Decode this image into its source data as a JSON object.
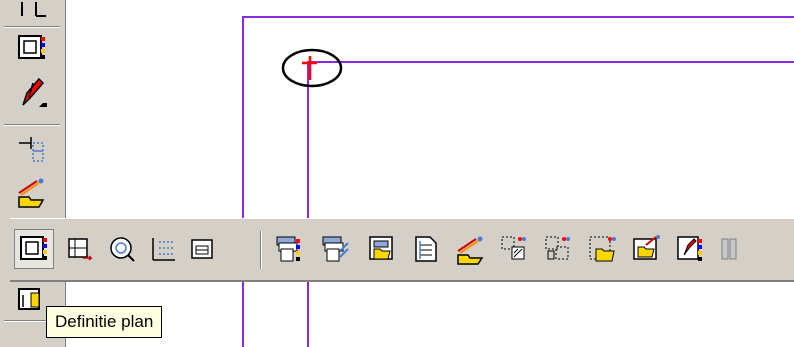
{
  "tooltip": {
    "text": "Definitie plan"
  },
  "colors": {
    "line": "#8a2be2",
    "toolbar": "#d4d0c8",
    "marker": "#ff0000",
    "tooltip_bg": "#ffffe1"
  },
  "vertical_toolbar": {
    "items": [
      {
        "icon": "frame-top-icon"
      },
      {
        "icon": "plan-frame-icon"
      },
      {
        "icon": "pencil-red-icon"
      },
      {
        "icon": "align-grid-icon"
      },
      {
        "icon": "open-folder-pen-icon"
      },
      {
        "icon": "text-frame-icon"
      }
    ]
  },
  "horizontal_toolbar": {
    "items": [
      {
        "icon": "definition-plan-icon",
        "pressed": true
      },
      {
        "icon": "grid-add-icon"
      },
      {
        "icon": "zoom-frame-icon"
      },
      {
        "icon": "grid-lines-icon"
      },
      {
        "icon": "window-frame-icon"
      },
      {
        "icon": "layer-stack-icon"
      },
      {
        "icon": "layer-stack-blue-icon"
      },
      {
        "icon": "folder-view-icon"
      },
      {
        "icon": "document-list-icon"
      },
      {
        "icon": "pen-folder-icon"
      },
      {
        "icon": "grid-hatch-icon"
      },
      {
        "icon": "grid-dots-icon"
      },
      {
        "icon": "folder-frame-icon"
      },
      {
        "icon": "folder-edit-icon"
      },
      {
        "icon": "frame-edit-icon"
      },
      {
        "icon": "columns-icon"
      }
    ]
  }
}
